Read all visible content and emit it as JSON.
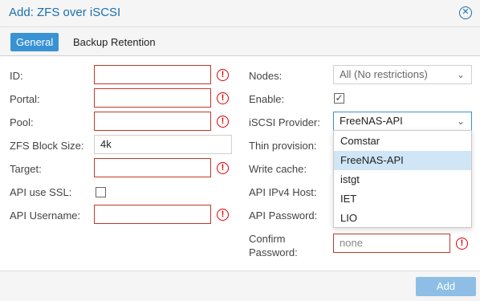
{
  "window": {
    "title": "Add: ZFS over iSCSI",
    "close_icon": "close-icon"
  },
  "tabs": [
    {
      "label": "General",
      "active": true
    },
    {
      "label": "Backup Retention",
      "active": false
    }
  ],
  "left": {
    "id": {
      "label": "ID:",
      "value": ""
    },
    "portal": {
      "label": "Portal:",
      "value": ""
    },
    "pool": {
      "label": "Pool:",
      "value": ""
    },
    "blocksize": {
      "label": "ZFS Block Size:",
      "value": "4k"
    },
    "target": {
      "label": "Target:",
      "value": ""
    },
    "ssl": {
      "label": "API use SSL:",
      "checked": false
    },
    "username": {
      "label": "API Username:",
      "value": ""
    }
  },
  "right": {
    "nodes": {
      "label": "Nodes:",
      "value": "All (No restrictions)"
    },
    "enable": {
      "label": "Enable:",
      "checked": true
    },
    "provider": {
      "label": "iSCSI Provider:",
      "value": "FreeNAS-API"
    },
    "thin": {
      "label": "Thin provision:"
    },
    "writecache": {
      "label": "Write cache:"
    },
    "ipv4host": {
      "label": "API IPv4 Host:"
    },
    "password": {
      "label": "API Password:"
    },
    "confirm": {
      "label_line1": "Confirm",
      "label_line2": "Password:",
      "value": "none"
    }
  },
  "dropdown": {
    "options": [
      "Comstar",
      "FreeNAS-API",
      "istgt",
      "IET",
      "LIO"
    ],
    "selected": "FreeNAS-API"
  },
  "error_glyph": "!",
  "checkmark": "✓",
  "arrow_glyph": "⌄",
  "footer": {
    "add_label": "Add"
  },
  "colors": {
    "accent": "#3892d4",
    "title": "#1a6fb0",
    "error": "#d00000",
    "selected_option": "#d0e5f5",
    "button_disabled": "#8ebee5"
  }
}
